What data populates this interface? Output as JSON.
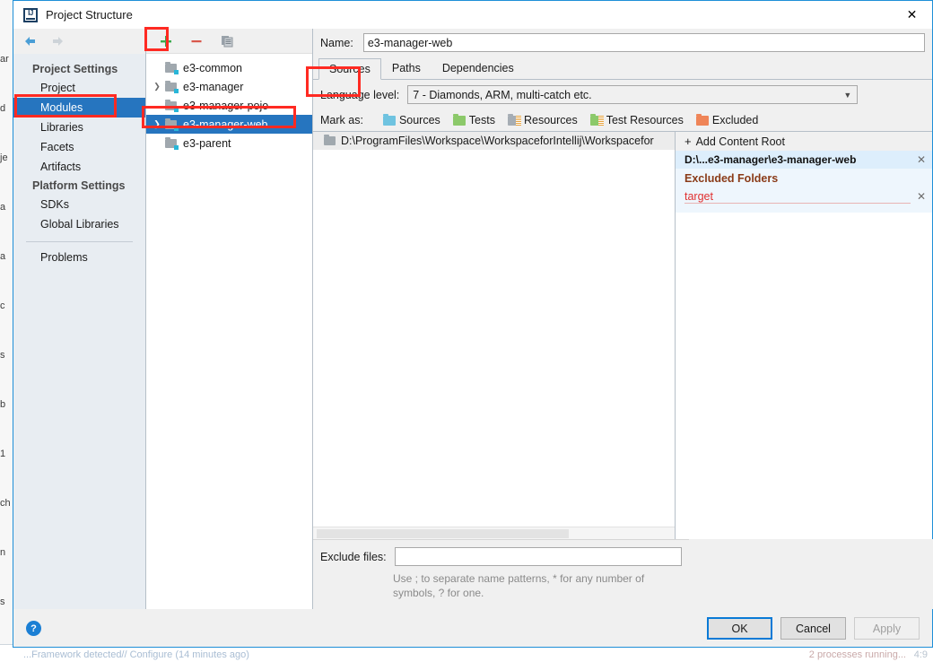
{
  "background": {
    "left_strip_text": [
      "ar",
      "d",
      "je",
      "a",
      "a",
      "c",
      "s",
      "b",
      "1",
      "ch",
      "n",
      "s"
    ],
    "status_left": "...Framework detected// Configure (14 minutes ago)",
    "status_right": "2 processes running...",
    "status_zoom": "4:9"
  },
  "dialog": {
    "title": "Project Structure",
    "logo_icon": "intellij-idea-logo-icon",
    "close_icon": "close-icon"
  },
  "nav_toolbar": {
    "back_icon": "arrow-left-icon",
    "forward_icon": "arrow-right-icon"
  },
  "sidebar": {
    "groups": [
      {
        "label": "Project Settings",
        "items": [
          {
            "label": "Project",
            "selected": false
          },
          {
            "label": "Modules",
            "selected": true
          },
          {
            "label": "Libraries",
            "selected": false
          },
          {
            "label": "Facets",
            "selected": false
          },
          {
            "label": "Artifacts",
            "selected": false
          }
        ]
      },
      {
        "label": "Platform Settings",
        "items": [
          {
            "label": "SDKs",
            "selected": false
          },
          {
            "label": "Global Libraries",
            "selected": false
          }
        ]
      }
    ],
    "problems": {
      "label": "Problems"
    }
  },
  "module_toolbar": {
    "add_icon": "plus-icon",
    "add_label": "+",
    "remove_icon": "minus-icon",
    "remove_label": "–",
    "copy_icon": "copy-icon"
  },
  "modules": [
    {
      "name": "e3-common",
      "expandable": false,
      "selected": false
    },
    {
      "name": "e3-manager",
      "expandable": true,
      "selected": false
    },
    {
      "name": "e3-manager-pojo",
      "expandable": false,
      "selected": false
    },
    {
      "name": "e3-manager-web",
      "expandable": true,
      "selected": true
    },
    {
      "name": "e3-parent",
      "expandable": false,
      "selected": false
    }
  ],
  "detail": {
    "name_label": "Name:",
    "name_value": "e3-manager-web",
    "tabs": [
      {
        "label": "Sources",
        "active": true
      },
      {
        "label": "Paths",
        "active": false
      },
      {
        "label": "Dependencies",
        "active": false
      }
    ],
    "language_level_label": "Language level:",
    "language_level_value": "7 - Diamonds, ARM, multi-catch etc.",
    "language_level_chevron": "chevron-down-icon",
    "mark_as_label": "Mark as:",
    "mark_as_options": [
      {
        "label": "Sources",
        "color": "#6fc3e0",
        "lines": false
      },
      {
        "label": "Tests",
        "color": "#8cc96a",
        "lines": false
      },
      {
        "label": "Resources",
        "color": "#a6adb4",
        "lines": true
      },
      {
        "label": "Test Resources",
        "color": "#8cc96a",
        "lines": true
      },
      {
        "label": "Excluded",
        "color": "#ef8558",
        "lines": false
      }
    ],
    "content_root_path": "D:\\ProgramFiles\\Workspace\\WorkspaceforIntellij\\Workspacefor",
    "add_content_root_label": "Add Content Root",
    "add_content_root_icon": "plus-icon",
    "root_path_short": "D:\\...e3-manager\\e3-manager-web",
    "root_remove_icon": "close-icon",
    "excluded_folders_label": "Excluded Folders",
    "excluded_folders": [
      {
        "name": "target",
        "remove_icon": "close-icon"
      }
    ],
    "exclude_files_label": "Exclude files:",
    "exclude_files_value": "",
    "exclude_files_hint": "Use ; to separate name patterns, * for any number of symbols, ? for one."
  },
  "buttons": {
    "help_label": "?",
    "help_icon": "help-icon",
    "ok": "OK",
    "cancel": "Cancel",
    "apply": "Apply"
  },
  "colors": {
    "selection_blue": "#2675bf",
    "accent_blue": "#1e8fd8",
    "annotation_red": "#ff2a22",
    "excluded_brown": "#8a3b18",
    "excluded_red": "#e03030"
  }
}
